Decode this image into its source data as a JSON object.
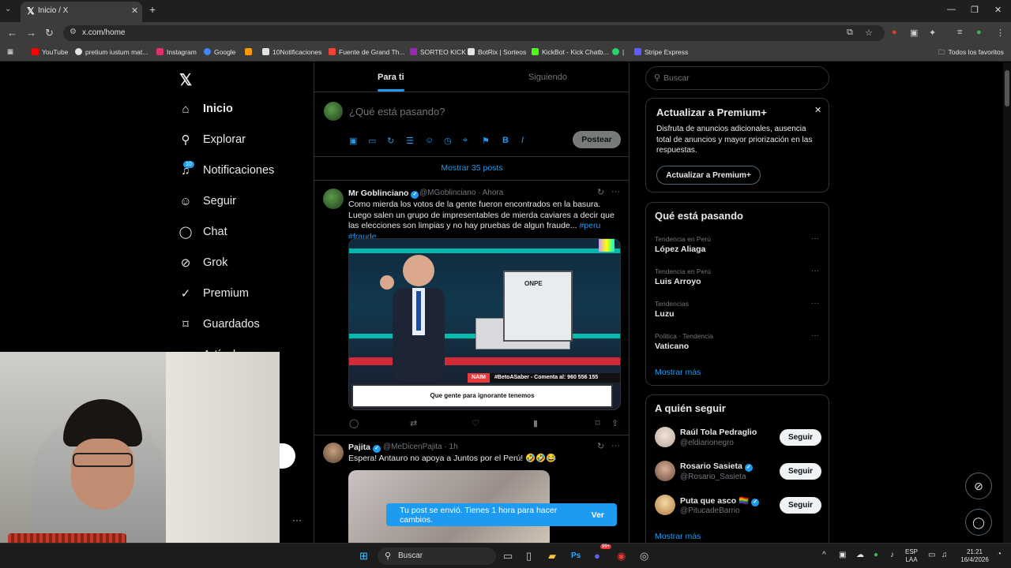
{
  "browser": {
    "tab_title": "Inicio / X",
    "url": "x.com/home",
    "bookmarks": [
      {
        "label": "YouTube",
        "color": "#ff0000"
      },
      {
        "label": "pretium iustum mat...",
        "color": "#e3e3e3"
      },
      {
        "label": "Instagram",
        "color": "#e1306c"
      },
      {
        "label": "Google",
        "color": "#4285f4"
      },
      {
        "label": "",
        "color": "#ff9800"
      },
      {
        "label": "10Notificaciones",
        "color": "#e3e3e3"
      },
      {
        "label": "Fuente de Grand Th...",
        "color": "#f44336"
      },
      {
        "label": "SORTEO KICK",
        "color": "#9c27b0"
      },
      {
        "label": "BotRix | Sorteos",
        "color": "#e3e3e3"
      },
      {
        "label": "KickBot - Kick Chatb...",
        "color": "#53fc18"
      },
      {
        "label": "|",
        "color": "#25d366"
      },
      {
        "label": "Stripe Express",
        "color": "#635bff"
      }
    ],
    "all_bookmarks": "Todos los favoritos"
  },
  "sidebar": {
    "notif_count": "10",
    "items": [
      {
        "label": "Inicio",
        "icon": "home-icon",
        "glyph": "⌂"
      },
      {
        "label": "Explorar",
        "icon": "search-icon",
        "glyph": "⚲"
      },
      {
        "label": "Notificaciones",
        "icon": "bell-icon",
        "glyph": "🔔"
      },
      {
        "label": "Seguir",
        "icon": "follow-icon",
        "glyph": "👤"
      },
      {
        "label": "Chat",
        "icon": "chat-icon",
        "glyph": "💬"
      },
      {
        "label": "Grok",
        "icon": "grok-icon",
        "glyph": "⊘"
      },
      {
        "label": "Premium",
        "icon": "premium-icon",
        "glyph": "✓"
      },
      {
        "label": "Guardados",
        "icon": "bookmark-icon",
        "glyph": "🔖"
      },
      {
        "label": "Artículos",
        "icon": "articles-icon",
        "glyph": "≡"
      }
    ]
  },
  "timeline": {
    "tab_foryou": "Para ti",
    "tab_following": "Siguiendo",
    "compose_placeholder": "¿Qué está pasando?",
    "post_button": "Postear",
    "show_posts": "Mostrar 35 posts",
    "posts": [
      {
        "name": "Mr Goblinciano",
        "handle": "@MGoblinciano · Ahora",
        "text": "Como mierda los votos de la gente fueron encontrados en la basura. Luego salen un grupo de impresentables de mierda caviares a decir que las elecciones son limpias y no hay pruebas de algun fraude...",
        "tags": "#peru #fraude",
        "media": {
          "onpe": "ONPE",
          "naim": "NAIM",
          "hashtag_bar": "#BetoASaber - Comenta al: 960 556 155",
          "caption": "Que gente para ignorante tenemos"
        }
      },
      {
        "name": "Pajita",
        "handle": "@MeDicenPajita · 1h",
        "text": "Espera! Antauro no apoya a Juntos por el Perú! 🤣🤣😂"
      }
    ],
    "toast_text": "Tu post se envió. Tienes 1 hora para hacer cambios.",
    "toast_action": "Ver"
  },
  "right": {
    "search_placeholder": "Buscar",
    "premium": {
      "title": "Actualizar a Premium+",
      "body": "Disfruta de anuncios adicionales, ausencia total de anuncios y mayor priorización en las respuestas.",
      "button": "Actualizar a Premium+"
    },
    "trends": {
      "title": "Qué está pasando",
      "items": [
        {
          "category": "Tendencia en Perú",
          "name": "López Aliaga"
        },
        {
          "category": "Tendencia en Perú",
          "name": "Luis Arroyo"
        },
        {
          "category": "Tendencias",
          "name": "Luzu"
        },
        {
          "category": "Política · Tendencia",
          "name": "Vaticano"
        }
      ],
      "show_more": "Mostrar más"
    },
    "follow": {
      "title": "A quién seguir",
      "items": [
        {
          "name": "Raúl Tola Pedraglio",
          "handle": "@eldiarionegro",
          "button": "Seguir"
        },
        {
          "name": "Rosario Sasieta",
          "handle": "@Rosario_Sasieta",
          "button": "Seguir"
        },
        {
          "name": "Puta que asco 🏳️‍🌈",
          "handle": "@PitucadeBarrio",
          "button": "Seguir"
        }
      ],
      "show_more": "Mostrar más"
    }
  },
  "taskbar": {
    "search": "Buscar",
    "lang": "ESP",
    "lang2": "LAA",
    "time": "21:21",
    "date": "16/4/2026",
    "badge_count": "99+"
  }
}
